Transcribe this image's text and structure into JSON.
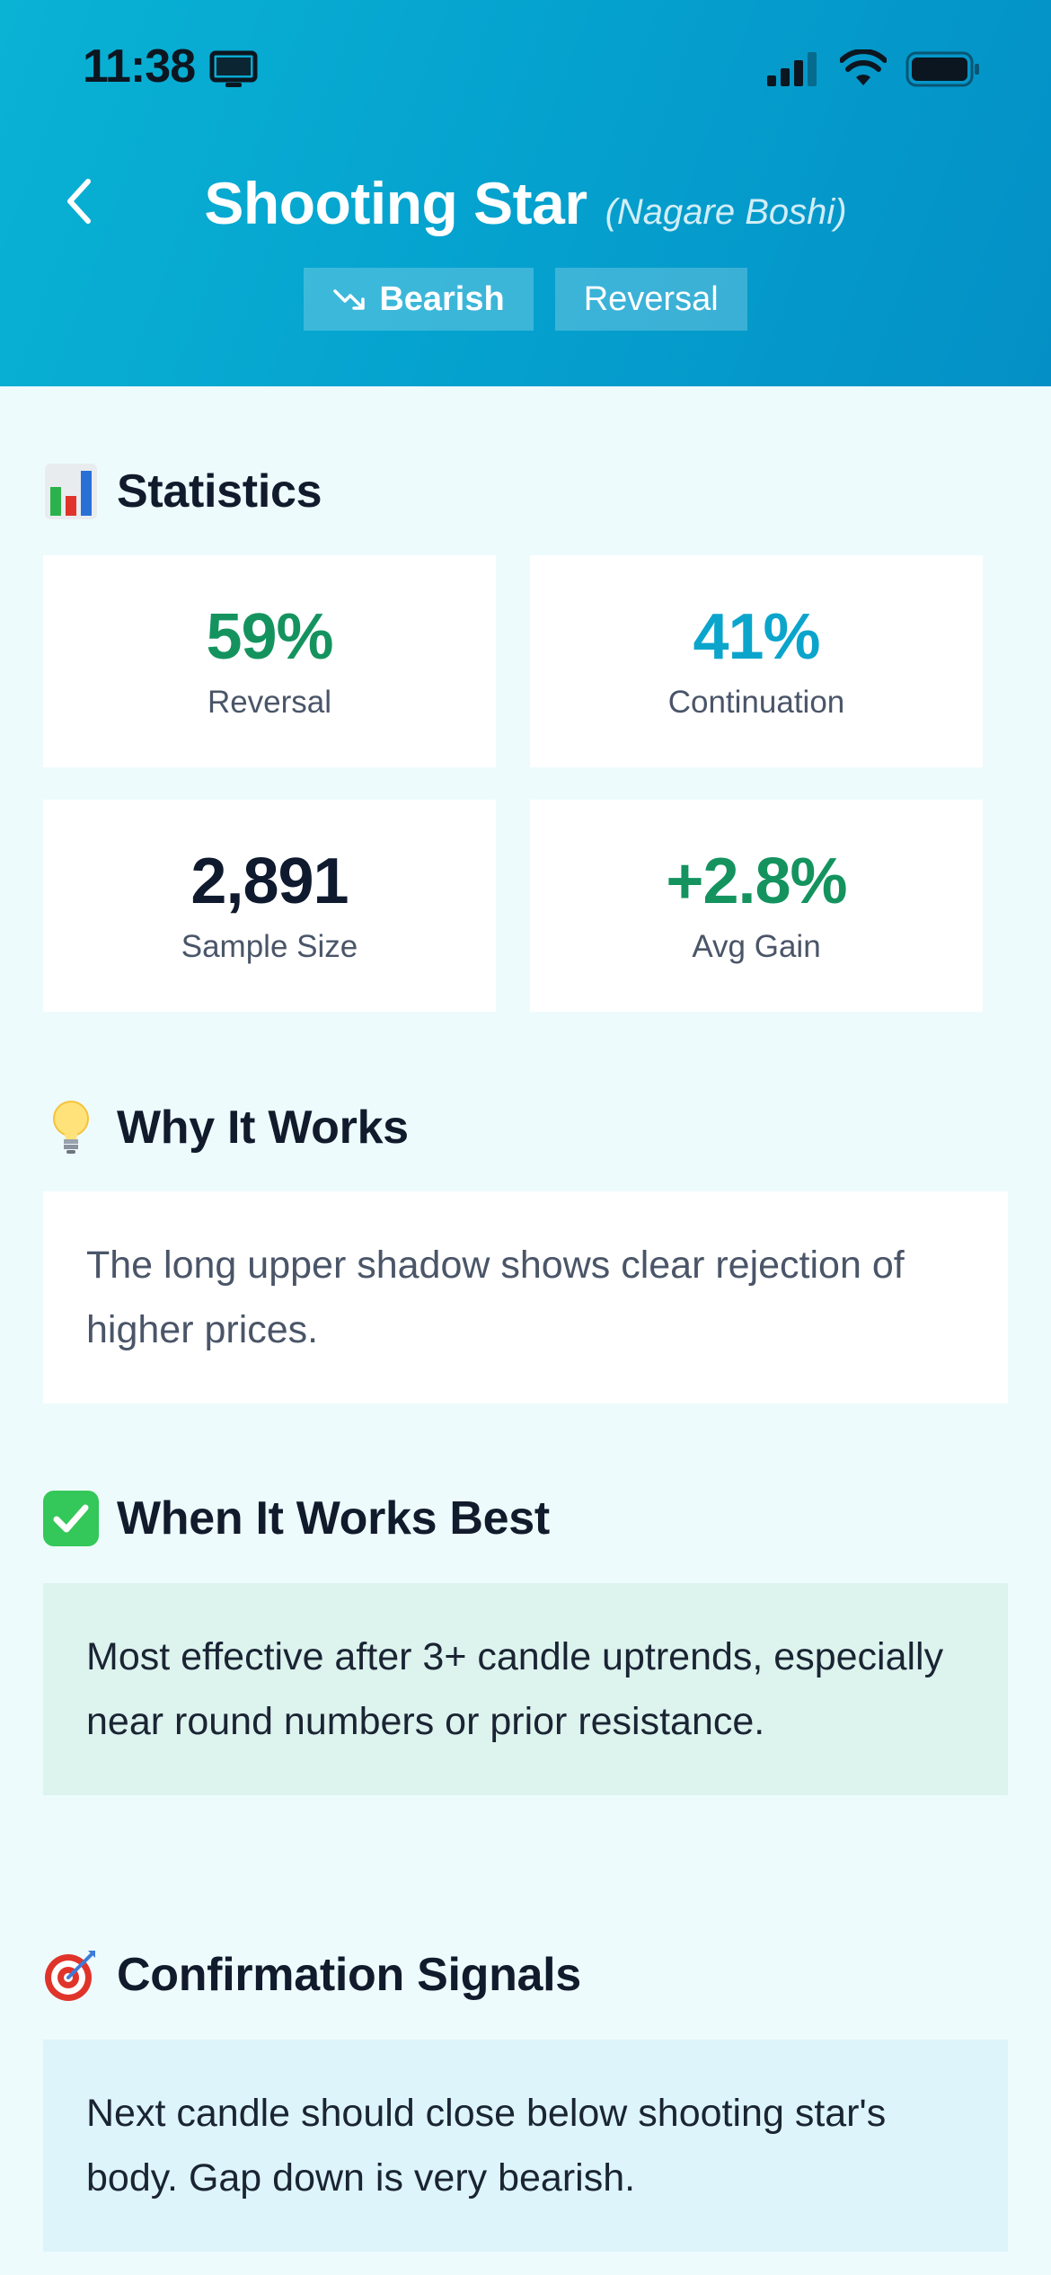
{
  "status_bar": {
    "time": "11:38"
  },
  "header": {
    "title": "Shooting Star",
    "subtitle": "(Nagare Boshi)",
    "tags": [
      {
        "label": "Bearish",
        "icon": "trend-down-icon"
      },
      {
        "label": "Reversal"
      }
    ]
  },
  "statistics": {
    "heading": "Statistics",
    "icon": "bar-chart-icon",
    "cards": [
      {
        "value": "59%",
        "label": "Reversal",
        "color": "#14935F"
      },
      {
        "value": "41%",
        "label": "Continuation",
        "color": "#0BA5CC"
      },
      {
        "value": "2,891",
        "label": "Sample Size",
        "color": "#0F1A2E"
      },
      {
        "value": "+2.8%",
        "label": "Avg Gain",
        "color": "#14935F"
      }
    ]
  },
  "why_it_works": {
    "heading": "Why It Works",
    "icon": "lightbulb-icon",
    "text": "The long upper shadow shows clear rejection of higher prices."
  },
  "when_it_works_best": {
    "heading": "When It Works Best",
    "icon": "check-mark-icon",
    "text": "Most effective after 3+ candle uptrends, especially near round numbers or prior resistance."
  },
  "confirmation_signals": {
    "heading": "Confirmation Signals",
    "icon": "target-icon",
    "text": "Next candle should close below shooting star's body. Gap down is very bearish."
  },
  "colors": {
    "header_gradient_start": "#0AB2D4",
    "header_gradient_end": "#0490C6",
    "page_background": "#EEFBFD",
    "positive_green": "#14935F",
    "accent_cyan": "#0BA5CC"
  }
}
